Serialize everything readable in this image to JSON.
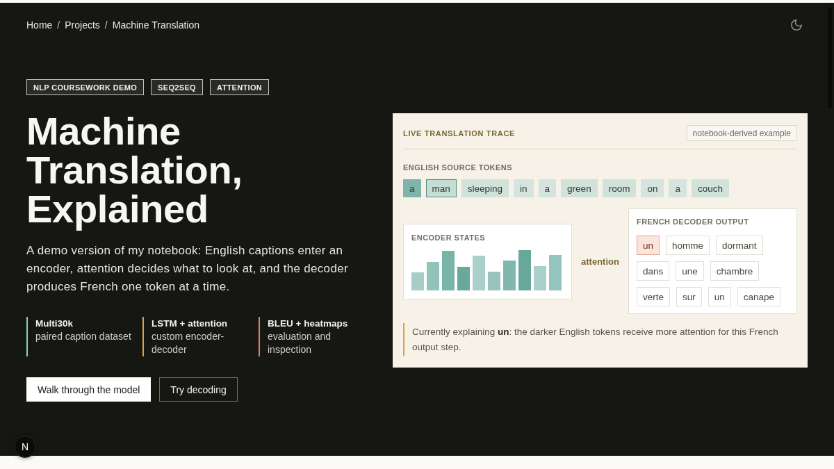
{
  "breadcrumb": [
    {
      "label": "Home",
      "separator": "/"
    },
    {
      "label": "Projects",
      "separator": "/"
    },
    {
      "label": "Machine Translation"
    }
  ],
  "tags": [
    "NLP COURSEWORK DEMO",
    "SEQ2SEQ",
    "ATTENTION"
  ],
  "title": "Machine Translation, Explained",
  "intro": "A demo version of my notebook: English captions enter an encoder, attention decides what to look at, and the decoder produces French one token at a time.",
  "stats": [
    {
      "title": "Multi30k",
      "description": "paired caption dataset",
      "color": "#86d3bf"
    },
    {
      "title": "LSTM + attention",
      "description": "custom encoder-decoder",
      "color": "#dfa34f"
    },
    {
      "title": "BLEU + heatmaps",
      "description": "evaluation and inspection",
      "color": "#dd8470"
    }
  ],
  "actions": [
    {
      "label": "Walk through the model",
      "kind": "primary"
    },
    {
      "label": "Try decoding",
      "kind": "secondary"
    }
  ],
  "trace": {
    "title": "LIVE TRANSLATION TRACE",
    "badge": "notebook-derived example",
    "source_label": "ENGLISH SOURCE TOKENS",
    "source_tokens": [
      {
        "text": "a",
        "color": "#80b4aa",
        "outlined": false
      },
      {
        "text": "man",
        "color": "#c5ddd4",
        "outlined": true
      },
      {
        "text": "sleeping",
        "color": "#d0e2da",
        "outlined": false
      },
      {
        "text": "in",
        "color": "#d5e4de",
        "outlined": false
      },
      {
        "text": "a",
        "color": "#d5e4de",
        "outlined": false
      },
      {
        "text": "green",
        "color": "#d0e2da",
        "outlined": false
      },
      {
        "text": "room",
        "color": "#d0e2da",
        "outlined": false
      },
      {
        "text": "on",
        "color": "#d5e4de",
        "outlined": false
      },
      {
        "text": "a",
        "color": "#d5e4de",
        "outlined": false
      },
      {
        "text": "couch",
        "color": "#d0e2da",
        "outlined": false
      }
    ],
    "encoder_label": "ENCODER STATES",
    "attention_label": "attention",
    "decoder_label": "FRENCH DECODER OUTPUT",
    "decoder_tokens": [
      {
        "text": "un",
        "selected": true
      },
      {
        "text": "homme",
        "selected": false
      },
      {
        "text": "dormant",
        "selected": false
      },
      {
        "text": "dans",
        "selected": false
      },
      {
        "text": "une",
        "selected": false
      },
      {
        "text": "chambre",
        "selected": false
      },
      {
        "text": "verte",
        "selected": false
      },
      {
        "text": "sur",
        "selected": false
      },
      {
        "text": "un",
        "selected": false
      },
      {
        "text": "canape",
        "selected": false
      }
    ],
    "explanation": "Currently explaining **un**: the darker English tokens receive more attention for this French output step."
  },
  "dev_indicator": {
    "text": "N"
  }
}
